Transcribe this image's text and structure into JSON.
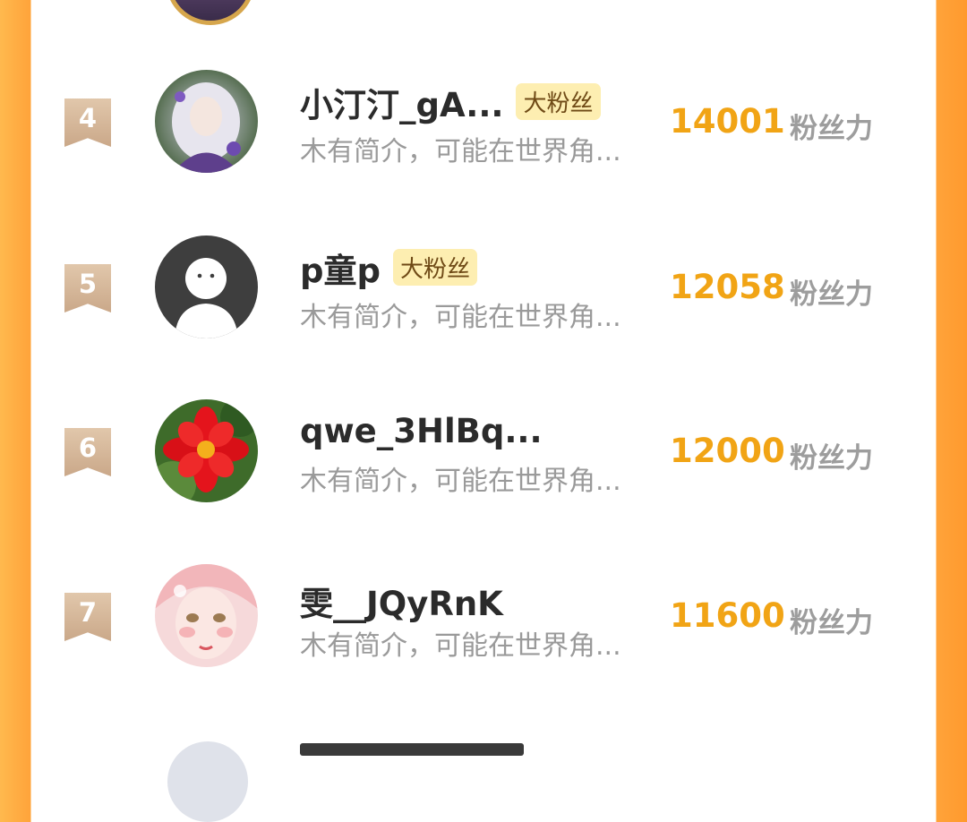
{
  "list": {
    "items": [
      {
        "rank": "4",
        "name": "小汀汀_gA...",
        "badge": "大粉丝",
        "intro": "木有简介，可能在世界角...",
        "score": "14001",
        "score_label": "粉丝力",
        "avatar": "anime-girl-avatar"
      },
      {
        "rank": "5",
        "name": "p童p",
        "badge": "大粉丝",
        "intro": "木有简介，可能在世界角...",
        "score": "12058",
        "score_label": "粉丝力",
        "avatar": "default-user-avatar"
      },
      {
        "rank": "6",
        "name": "qwe_3HlBq...",
        "badge": "",
        "intro": "木有简介，可能在世界角...",
        "score": "12000",
        "score_label": "粉丝力",
        "avatar": "red-flower-avatar"
      },
      {
        "rank": "7",
        "name": "雯__JQyRnK",
        "badge": "",
        "intro": "木有简介，可能在世界角...",
        "score": "11600",
        "score_label": "粉丝力",
        "avatar": "pink-girl-avatar"
      }
    ]
  },
  "colors": {
    "accent_orange": "#ffa33a",
    "score_gold": "#f1a415",
    "badge_bg": "#fdeeb1",
    "rank_badge": "#d7bb9e"
  }
}
